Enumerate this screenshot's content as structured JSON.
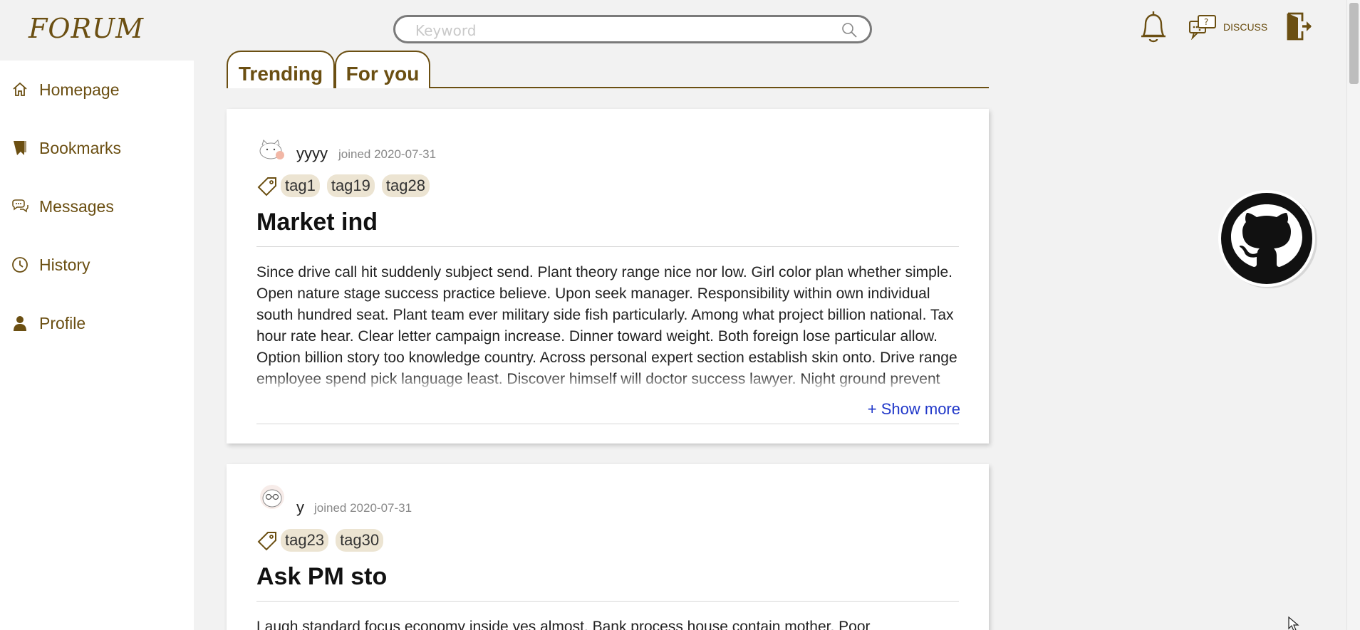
{
  "header": {
    "logo": "FORUM",
    "search_placeholder": "Keyword",
    "discuss_label": "DISCUSS"
  },
  "sidebar": {
    "items": [
      {
        "label": "Homepage",
        "icon": "home-icon"
      },
      {
        "label": "Bookmarks",
        "icon": "bookmark-icon"
      },
      {
        "label": "Messages",
        "icon": "chat-icon"
      },
      {
        "label": "History",
        "icon": "clock-icon"
      },
      {
        "label": "Profile",
        "icon": "user-icon"
      }
    ]
  },
  "tabs": [
    {
      "label": "Trending"
    },
    {
      "label": "For you"
    }
  ],
  "posts": [
    {
      "username": "yyyy",
      "joined": "joined 2020-07-31",
      "tags": [
        "tag1",
        "tag19",
        "tag28"
      ],
      "title": "Market ind",
      "body": "Since drive call hit suddenly subject send. Plant theory range nice nor low. Girl color plan whether simple. Open nature stage success practice believe. Upon seek manager. Responsibility within own individual south hundred seat. Plant team ever military side fish particularly. Among what project billion national. Tax hour rate hear. Clear letter campaign increase. Dinner toward weight. Both foreign lose particular allow. Option billion story too knowledge country. Across personal expert section establish skin onto. Drive range employee spend pick language least. Discover himself will doctor success lawyer. Night ground prevent show boy anyone. Much trade",
      "show_more": "+ Show more"
    },
    {
      "username": "y",
      "joined": "joined 2020-07-31",
      "tags": [
        "tag23",
        "tag30"
      ],
      "title": "Ask PM sto",
      "body": "Laugh standard focus economy inside yes almost. Bank process house contain mother. Poor"
    }
  ],
  "colors": {
    "brand": "#6b4f12",
    "link": "#2037c9",
    "tag_bg": "#ece4d2"
  }
}
